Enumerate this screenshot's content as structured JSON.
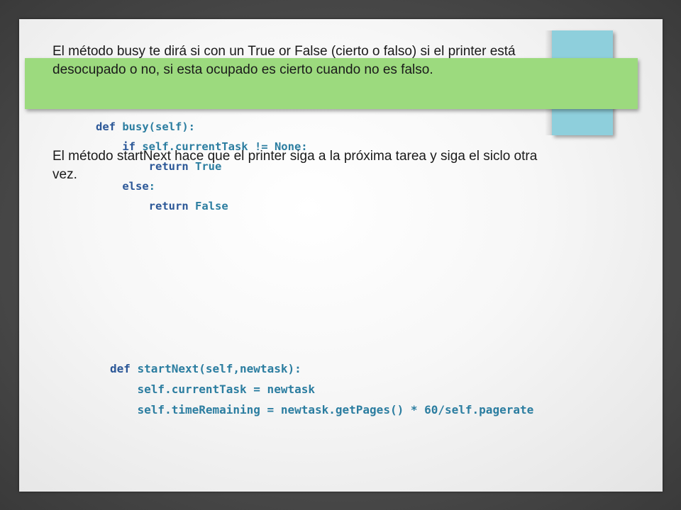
{
  "slide": {
    "paragraph_1": "El método busy te dirá si con un True or False (cierto o falso) si el printer está desocupado o no, si esta ocupado es cierto cuando no es falso.",
    "paragraph_2": "El método startNext hace que el printer siga a la próxima tarea y siga el siclo otra vez."
  },
  "code_busy": {
    "lines": [
      "def busy(self):",
      "    if self.currentTask != None:",
      "        return True",
      "    else:",
      "        return False"
    ]
  },
  "code_startnext": {
    "lines": [
      "def startNext(self,newtask):",
      "    self.currentTask = newtask",
      "    self.timeRemaining = newtask.getPages() * 60/self.pagerate"
    ]
  },
  "colors": {
    "green_banner": "#9cda7e",
    "blue_rect": "#8ecfdc",
    "code_keyword": "#2b5797",
    "code_text": "#2b7da0"
  }
}
